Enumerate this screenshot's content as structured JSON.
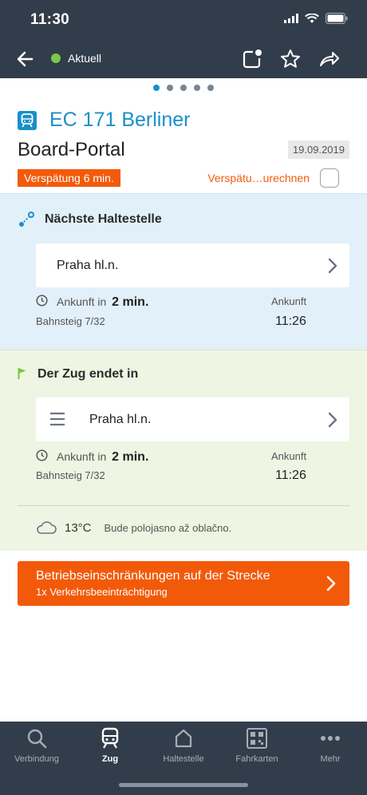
{
  "status": {
    "time": "11:30"
  },
  "header": {
    "status_label": "Aktuell"
  },
  "pager": {
    "count": 5,
    "active": 0
  },
  "train": {
    "name": "EC 171 Berliner",
    "portal": "Board-Portal",
    "date": "19.09.2019",
    "delay": "Verspätung 6 min.",
    "delay_calc_label": "Verspätu…urechnen"
  },
  "next_stop": {
    "title": "Nächste Haltestelle",
    "station": "Praha hl.n.",
    "arrival_prefix": "Ankunft in",
    "arrival_in": "2 min.",
    "platform": "Bahnsteig 7/32",
    "arrival_head": "Ankunft",
    "arrival_time": "11:26"
  },
  "end_stop": {
    "title": "Der Zug endet in",
    "station": "Praha hl.n.",
    "arrival_prefix": "Ankunft in",
    "arrival_in": "2 min.",
    "platform": "Bahnsteig 7/32",
    "arrival_head": "Ankunft",
    "arrival_time": "11:26"
  },
  "weather": {
    "temp": "13°C",
    "desc": "Bude polojasno až oblačno."
  },
  "banner": {
    "title": "Betriebseinschränkungen auf der Strecke",
    "subtitle": "1x Verkehrsbeeinträchtigung"
  },
  "tabs": [
    {
      "label": "Verbindung",
      "icon": "search-icon"
    },
    {
      "label": "Zug",
      "icon": "train-icon"
    },
    {
      "label": "Haltestelle",
      "icon": "house-icon"
    },
    {
      "label": "Fahrkarten",
      "icon": "qr-code-icon"
    },
    {
      "label": "Mehr",
      "icon": "more-dots-icon"
    }
  ],
  "colors": {
    "header_bg": "#323d4b",
    "accent_blue": "#1a8fc9",
    "accent_orange": "#f25a0a",
    "next_bg": "#e2f0f9",
    "end_bg": "#eef5e2"
  }
}
